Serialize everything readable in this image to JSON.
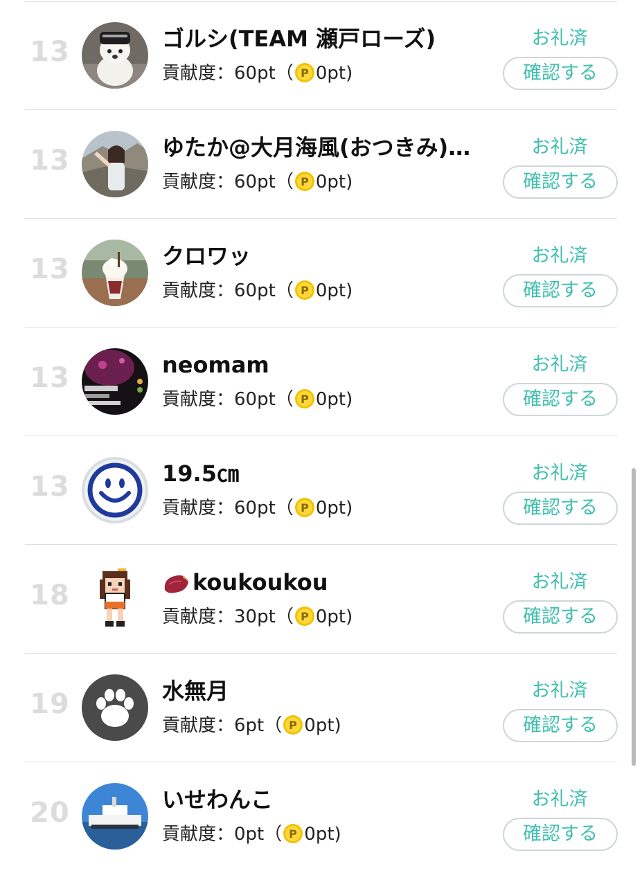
{
  "ranking": {
    "thanks_label": "お礼済",
    "confirm_label": "確認する",
    "contrib_prefix": "貢献度：",
    "coin_icon": "p-coin-icon",
    "entries": [
      {
        "rank": "13",
        "name": "ゴルシ(TEAM 瀬戸ローズ)",
        "points": "60pt",
        "paren_open": "（",
        "coin_points": "0pt)",
        "avatar": "plush-toy-photo"
      },
      {
        "rank": "13",
        "name": "ゆたか@大月海風(おつきみ)…",
        "points": "60pt",
        "paren_open": "（",
        "coin_points": "0pt)",
        "avatar": "person-mountain-photo"
      },
      {
        "rank": "13",
        "name": "クロワッ",
        "points": "60pt",
        "paren_open": "（",
        "coin_points": "0pt)",
        "avatar": "parfait-photo"
      },
      {
        "rank": "13",
        "name": "neomam",
        "points": "60pt",
        "paren_open": "（",
        "coin_points": "0pt)",
        "avatar": "dark-purple-screenshot"
      },
      {
        "rank": "13",
        "name": "19.5㎝",
        "points": "60pt",
        "paren_open": "（",
        "coin_points": "0pt)",
        "avatar": "smiley-bowl"
      },
      {
        "rank": "18",
        "name": "koukoukou",
        "name_emoji": "sweet-potato-icon",
        "points": "30pt",
        "paren_open": "（",
        "coin_points": "0pt)",
        "avatar": "pixel-girl"
      },
      {
        "rank": "19",
        "name": "水無月",
        "points": "6pt",
        "paren_open": "（",
        "coin_points": "0pt)",
        "avatar": "paw-icon"
      },
      {
        "rank": "20",
        "name": "いせわんこ",
        "points": "0pt",
        "paren_open": "（",
        "coin_points": "0pt)",
        "avatar": "ship-photo"
      }
    ]
  },
  "colors": {
    "accent": "#3fbfae",
    "rank_text": "#dcdcdc",
    "coin": "#f2c200",
    "divider": "#dedede"
  }
}
